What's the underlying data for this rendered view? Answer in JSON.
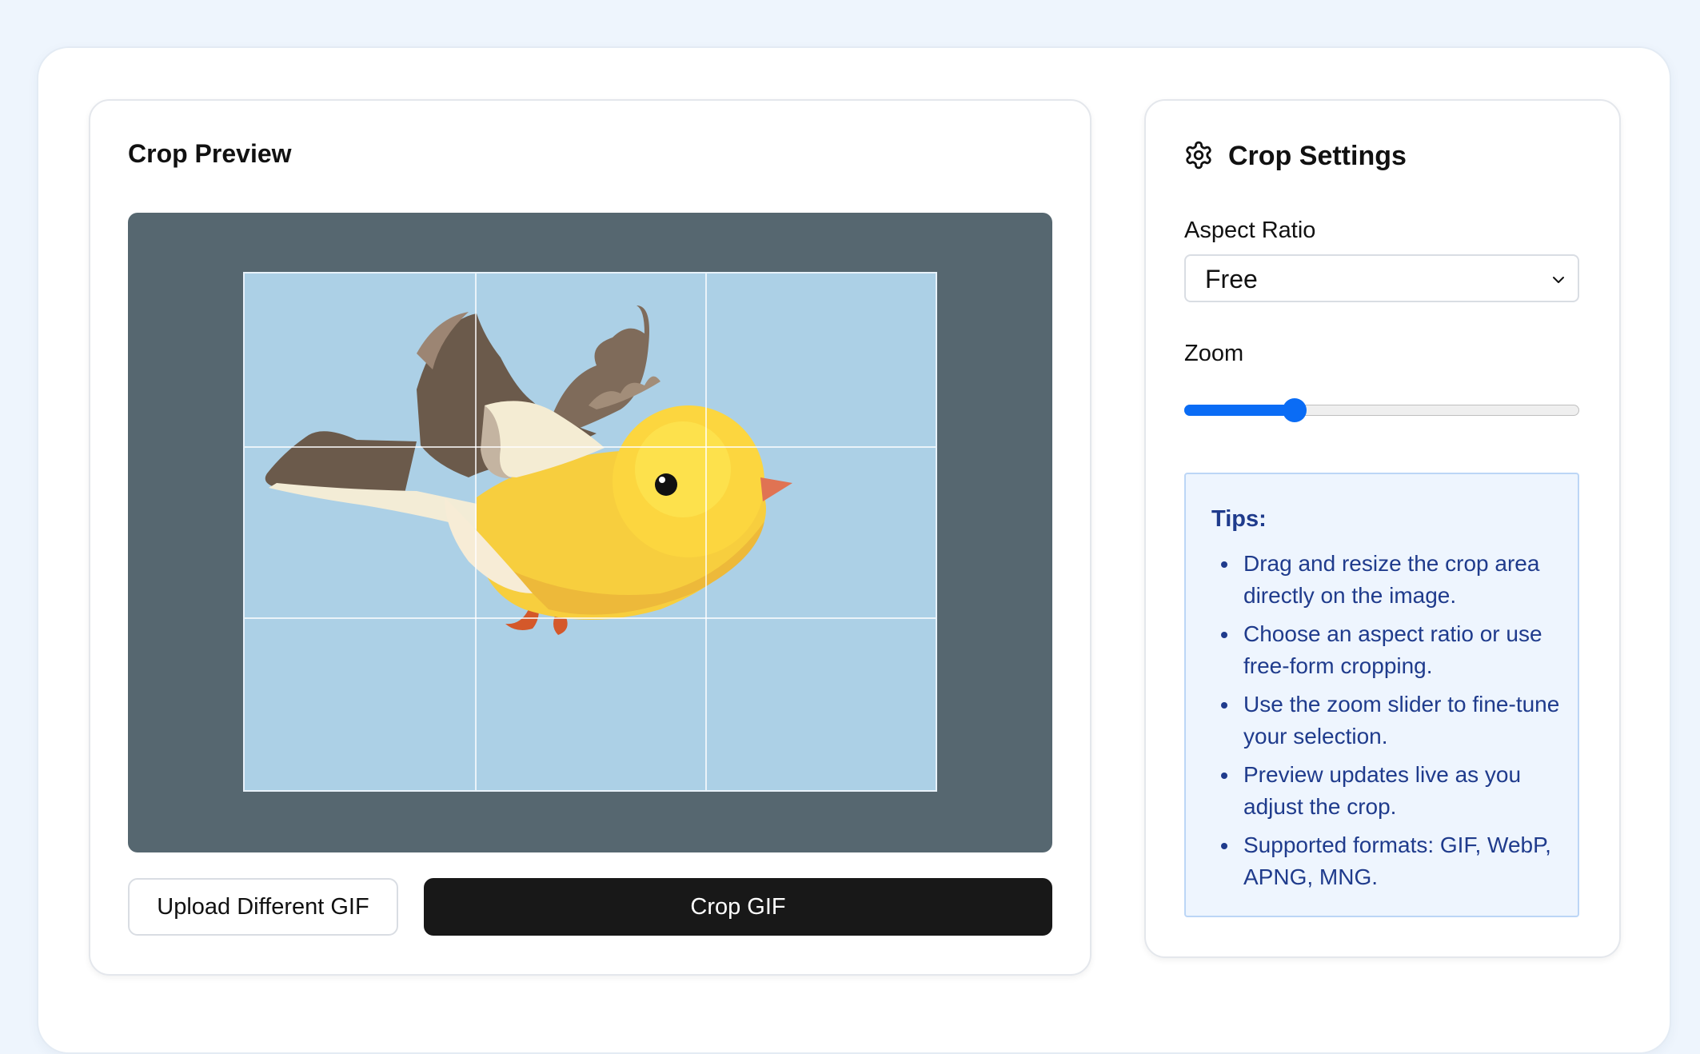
{
  "preview": {
    "title": "Crop Preview",
    "upload_button": "Upload Different GIF",
    "crop_button": "Crop GIF"
  },
  "settings": {
    "title": "Crop Settings",
    "aspect_ratio_label": "Aspect Ratio",
    "aspect_ratio_value": "Free",
    "zoom_label": "Zoom",
    "zoom_level": 0.28
  },
  "tips": {
    "title": "Tips:",
    "items": [
      "Drag and resize the crop area directly on the image.",
      "Choose an aspect ratio or use free-form cropping.",
      "Use the zoom slider to fine-tune your selection.",
      "Preview updates live as you adjust the crop.",
      "Supported formats: GIF, WebP, APNG, MNG."
    ]
  },
  "icons": {
    "settings": "gear-icon",
    "select": "chevron-down-icon"
  },
  "colors": {
    "canvas_bg": "#566770",
    "crop_bg": "#acd0e6",
    "accent": "#0a6cf5",
    "primary_button": "#181818",
    "tips_text": "#1f3b8c"
  }
}
